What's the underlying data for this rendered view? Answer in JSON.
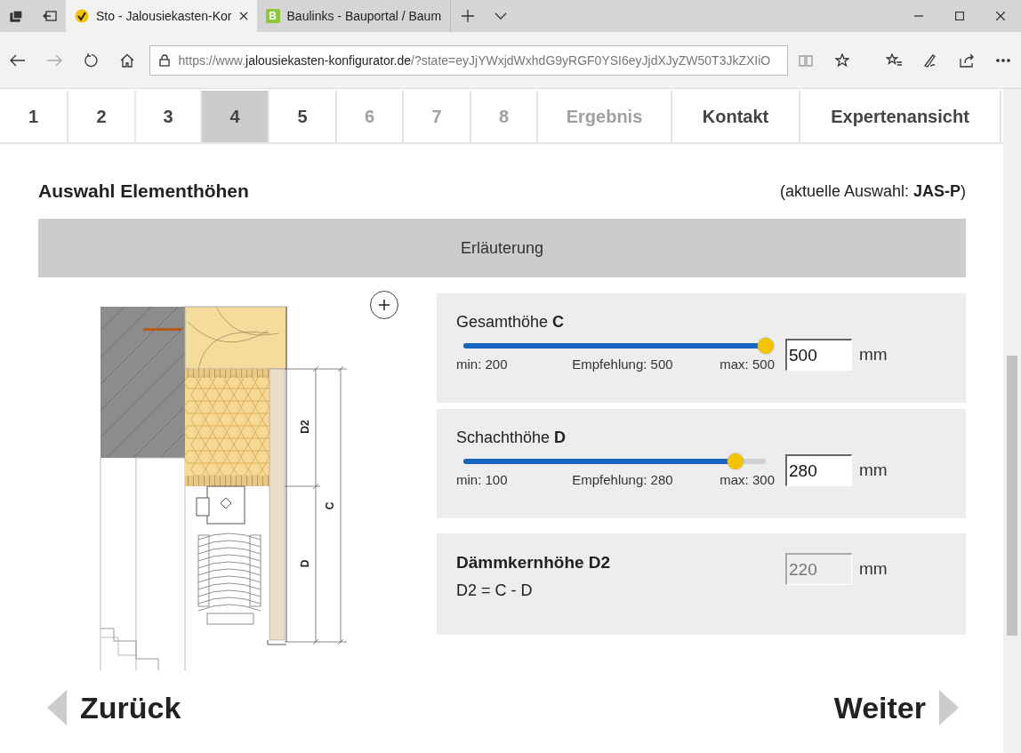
{
  "browser": {
    "tabs": [
      {
        "kind": "check",
        "title": "Sto - Jalousiekasten-Kor",
        "selected": true
      },
      {
        "kind": "letter",
        "favicon_text": "B",
        "title": "Baulinks - Bauportal / Baum",
        "selected": false
      }
    ],
    "address": {
      "prefix": "https://www.",
      "host": "jalousiekasten-konfigurator.de",
      "rest": "/?state=eyJjYWxjdWxhdG9yRGF0YSI6eyJjdXJyZW50T3JkZXIiO"
    }
  },
  "steps": [
    {
      "label": "1",
      "selected": false,
      "disabled": false
    },
    {
      "label": "2",
      "selected": false,
      "disabled": false
    },
    {
      "label": "3",
      "selected": false,
      "disabled": false
    },
    {
      "label": "4",
      "selected": true,
      "disabled": false
    },
    {
      "label": "5",
      "selected": false,
      "disabled": false
    },
    {
      "label": "6",
      "selected": false,
      "disabled": true
    },
    {
      "label": "7",
      "selected": false,
      "disabled": true
    },
    {
      "label": "8",
      "selected": false,
      "disabled": true
    },
    {
      "label": "Ergebnis",
      "selected": false,
      "disabled": true
    },
    {
      "label": "Kontakt",
      "selected": false,
      "disabled": false
    },
    {
      "label": "Expertenansicht",
      "selected": false,
      "disabled": false
    }
  ],
  "section": {
    "title": "Auswahl Elementhöhen",
    "current": "(aktuelle Auswahl: **JAS-P**)",
    "explanation": "Erläuterung"
  },
  "drawing": {
    "labels": [
      "D2",
      "C",
      "D"
    ]
  },
  "params": [
    {
      "kind": "slider",
      "label": "Gesamthöhe **C**",
      "level": 1,
      "min": "min: 200",
      "recommended": "Empfehlung: 500",
      "max": "max: 500",
      "value": "500",
      "unit": "mm",
      "disabled": false
    },
    {
      "kind": "slider",
      "label": "Schachthöhe **D**",
      "level": 0.9,
      "min": "min: 100",
      "recommended": "Empfehlung: 280",
      "max": "max: 300",
      "value": "280",
      "unit": "mm",
      "disabled": false
    },
    {
      "kind": "formula",
      "label": "Dämmkernhöhe D2",
      "formula": "D2 = C - D",
      "value": "220",
      "unit": "mm",
      "disabled": true
    }
  ],
  "nav": {
    "back": "Zurück",
    "next": "Weiter"
  }
}
